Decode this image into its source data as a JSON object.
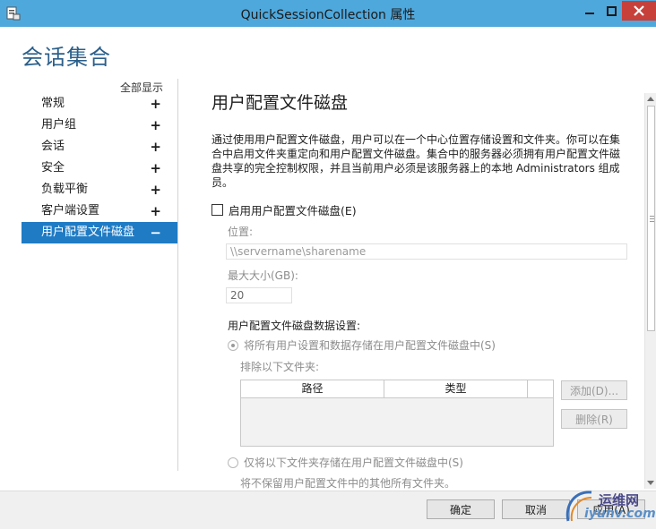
{
  "window": {
    "title": "QuickSessionCollection 属性",
    "buttons": {
      "minimize_icon": "minimize-icon",
      "maximize_icon": "maximize-icon",
      "close_icon": "close-icon"
    }
  },
  "dialog_title": "会话集合",
  "nav": {
    "show_all": "全部显示",
    "items": [
      {
        "label": "常规",
        "sign": "+"
      },
      {
        "label": "用户组",
        "sign": "+"
      },
      {
        "label": "会话",
        "sign": "+"
      },
      {
        "label": "安全",
        "sign": "+"
      },
      {
        "label": "负载平衡",
        "sign": "+"
      },
      {
        "label": "客户端设置",
        "sign": "+"
      },
      {
        "label": "用户配置文件磁盘",
        "sign": "−",
        "active": true
      }
    ]
  },
  "content": {
    "title": "用户配置文件磁盘",
    "description": "通过使用用户配置文件磁盘，用户可以在一个中心位置存储设置和文件夹。你可以在集合中启用文件夹重定向和用户配置文件磁盘。集合中的服务器必须拥有用户配置文件磁盘共享的完全控制权限，并且当前用户必须是该服务器上的本地 Administrators 组成员。",
    "enable_checkbox": {
      "label": "启用用户配置文件磁盘(E)",
      "checked": false
    },
    "location_label": "位置:",
    "location_placeholder": "\\\\servername\\sharename",
    "max_size_label": "最大大小(GB):",
    "max_size_value": "20",
    "data_settings_label": "用户配置文件磁盘数据设置:",
    "radio_all": "将所有用户设置和数据存储在用户配置文件磁盘中(S)",
    "exclude_label": "排除以下文件夹:",
    "table_headers": {
      "path": "路径",
      "type": "类型"
    },
    "add_button": "添加(D)...",
    "delete_button": "删除(R)",
    "radio_only": "仅将以下文件夹存储在用户配置文件磁盘中(S)",
    "not_kept_note": "将不保留用户配置文件中的其他所有文件夹。"
  },
  "footer": {
    "ok": "确定",
    "cancel": "取消",
    "apply": "应用(A)"
  },
  "watermark": {
    "line1": "运维网",
    "line2": "iyunv.com"
  }
}
